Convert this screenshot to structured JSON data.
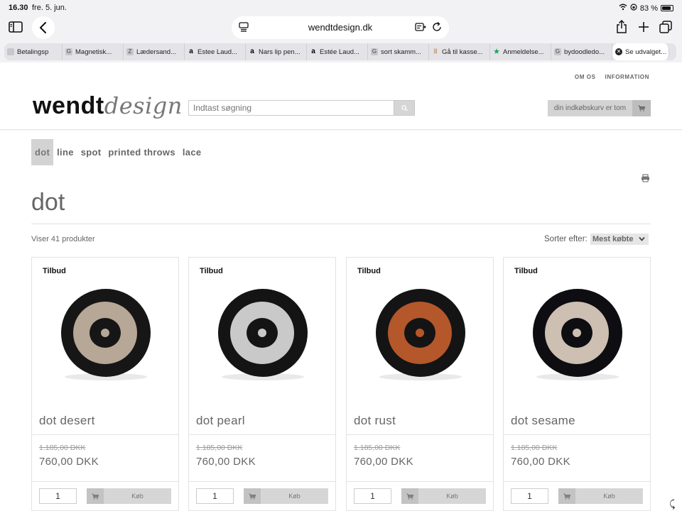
{
  "status": {
    "time": "16.30",
    "date": "fre. 5. jun.",
    "battery": "83 %",
    "battery_level": 0.83
  },
  "browser": {
    "url": "wendtdesign.dk",
    "tabs": [
      {
        "label": "Betalingsp",
        "icon": "doc-icon"
      },
      {
        "label": "Magnetisk...",
        "icon": "g-icon"
      },
      {
        "label": "Lædersand...",
        "icon": "zara-icon"
      },
      {
        "label": "Estee Laud...",
        "icon": "amazon-icon"
      },
      {
        "label": "Nars lip pen...",
        "icon": "amazon-icon"
      },
      {
        "label": "Estée Laud...",
        "icon": "amazon-icon"
      },
      {
        "label": "sort skamm...",
        "icon": "g-icon"
      },
      {
        "label": "Gå til kasse...",
        "icon": "bars-icon"
      },
      {
        "label": "Anmeldelse...",
        "icon": "star-icon"
      },
      {
        "label": "bydoodledo...",
        "icon": "g-icon"
      },
      {
        "label": "Se udvalget...",
        "icon": "close-icon",
        "active": true
      }
    ]
  },
  "site": {
    "toplinks": [
      "OM OS",
      "INFORMATION"
    ],
    "logo_bold": "wendt",
    "logo_italic": "design",
    "search_placeholder": "Indtast søgning",
    "cart_text": "din indkøbskurv er tom",
    "categories": [
      {
        "label": "dot",
        "active": true
      },
      {
        "label": "line"
      },
      {
        "label": "spot"
      },
      {
        "label": "printed throws"
      },
      {
        "label": "lace"
      }
    ],
    "page_title": "dot",
    "product_count": "Viser 41 produkter",
    "sort_label": "Sorter efter:",
    "sort_value": "Mest købte"
  },
  "products": [
    {
      "badge": "Tilbud",
      "name": "dot desert",
      "old_price": "1.185,00 DKK",
      "price": "760,00 DKK",
      "qty": "1",
      "buy_label": "Køb",
      "colors": {
        "outer": "#161616",
        "ring": "#b6a796",
        "center": "#161616"
      }
    },
    {
      "badge": "Tilbud",
      "name": "dot pearl",
      "old_price": "1.185,00 DKK",
      "price": "760,00 DKK",
      "qty": "1",
      "buy_label": "Køb",
      "colors": {
        "outer": "#141414",
        "ring": "#c9c9c9",
        "center": "#141414"
      }
    },
    {
      "badge": "Tilbud",
      "name": "dot rust",
      "old_price": "1.185,00 DKK",
      "price": "760,00 DKK",
      "qty": "1",
      "buy_label": "Køb",
      "colors": {
        "outer": "#141414",
        "ring": "#b4572a",
        "center": "#141414"
      }
    },
    {
      "badge": "Tilbud",
      "name": "dot sesame",
      "old_price": "1.185,00 DKK",
      "price": "760,00 DKK",
      "qty": "1",
      "buy_label": "Køb",
      "colors": {
        "outer": "#0d0d12",
        "ring": "#cdbfb1",
        "center": "#0d0d12"
      }
    }
  ]
}
